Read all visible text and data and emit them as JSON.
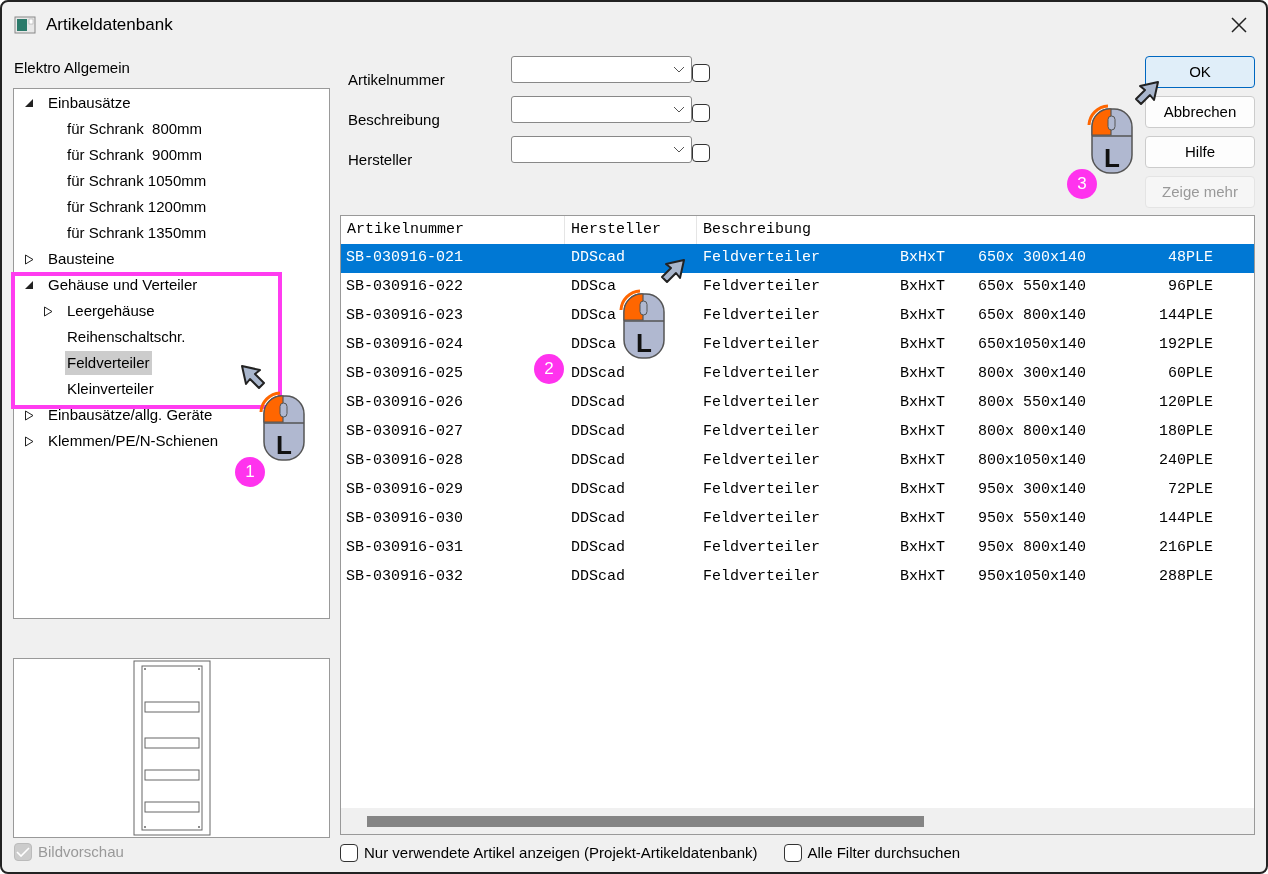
{
  "window": {
    "title": "Artikeldatenbank"
  },
  "catalog_label": "Elektro Allgemein",
  "tree": [
    {
      "label": "Einbausätze",
      "expanded": true,
      "selected": false,
      "children": [
        {
          "label": "für Schrank  800mm",
          "selected": false
        },
        {
          "label": "für Schrank  900mm",
          "selected": false
        },
        {
          "label": "für Schrank 1050mm",
          "selected": false
        },
        {
          "label": "für Schrank 1200mm",
          "selected": false
        },
        {
          "label": "für Schrank 1350mm",
          "selected": false
        }
      ]
    },
    {
      "label": "Bausteine",
      "expanded": false,
      "selected": false
    },
    {
      "label": "Gehäuse und Verteiler",
      "expanded": true,
      "selected": false,
      "children": [
        {
          "label": "Leergehäuse",
          "expanded": false,
          "selected": false
        },
        {
          "label": "Reihenschaltschr.",
          "selected": false
        },
        {
          "label": "Feldverteiler",
          "selected": true
        },
        {
          "label": "Kleinverteiler",
          "selected": false
        }
      ]
    },
    {
      "label": "Einbausätze/allg. Geräte",
      "expanded": false,
      "selected": false
    },
    {
      "label": "Klemmen/PE/N-Schienen",
      "expanded": false,
      "selected": false
    }
  ],
  "preview_checkbox": {
    "label": "Bildvorschau",
    "checked": true,
    "disabled": true
  },
  "filters": [
    {
      "label": "Artikelnummer",
      "checked": false
    },
    {
      "label": "Beschreibung",
      "checked": false
    },
    {
      "label": "Hersteller",
      "checked": false
    }
  ],
  "buttons": [
    {
      "label": "OK",
      "default": true,
      "disabled": false
    },
    {
      "label": "Abbrechen",
      "default": false,
      "disabled": false
    },
    {
      "label": "Hilfe",
      "default": false,
      "disabled": false
    },
    {
      "label": "Zeige mehr",
      "default": false,
      "disabled": true
    }
  ],
  "table": {
    "columns": [
      "Artikelnummer",
      "Hersteller",
      "Beschreibung"
    ],
    "rows": [
      {
        "selected": true,
        "cells": [
          "SB-030916-021",
          "DDScad",
          "Feldverteiler",
          "BxHxT",
          "650x 300x140",
          "48PLE"
        ]
      },
      {
        "selected": false,
        "cells": [
          "SB-030916-022",
          "DDSca",
          "Feldverteiler",
          "BxHxT",
          "650x 550x140",
          "96PLE"
        ]
      },
      {
        "selected": false,
        "cells": [
          "SB-030916-023",
          "DDSca",
          "Feldverteiler",
          "BxHxT",
          "650x 800x140",
          "144PLE"
        ]
      },
      {
        "selected": false,
        "cells": [
          "SB-030916-024",
          "DDSca",
          "Feldverteiler",
          "BxHxT",
          "650x1050x140",
          "192PLE"
        ]
      },
      {
        "selected": false,
        "cells": [
          "SB-030916-025",
          "DDScad",
          "Feldverteiler",
          "BxHxT",
          "800x 300x140",
          "60PLE"
        ]
      },
      {
        "selected": false,
        "cells": [
          "SB-030916-026",
          "DDScad",
          "Feldverteiler",
          "BxHxT",
          "800x 550x140",
          "120PLE"
        ]
      },
      {
        "selected": false,
        "cells": [
          "SB-030916-027",
          "DDScad",
          "Feldverteiler",
          "BxHxT",
          "800x 800x140",
          "180PLE"
        ]
      },
      {
        "selected": false,
        "cells": [
          "SB-030916-028",
          "DDScad",
          "Feldverteiler",
          "BxHxT",
          "800x1050x140",
          "240PLE"
        ]
      },
      {
        "selected": false,
        "cells": [
          "SB-030916-029",
          "DDScad",
          "Feldverteiler",
          "BxHxT",
          "950x 300x140",
          "72PLE"
        ]
      },
      {
        "selected": false,
        "cells": [
          "SB-030916-030",
          "DDScad",
          "Feldverteiler",
          "BxHxT",
          "950x 550x140",
          "144PLE"
        ]
      },
      {
        "selected": false,
        "cells": [
          "SB-030916-031",
          "DDScad",
          "Feldverteiler",
          "BxHxT",
          "950x 800x140",
          "216PLE"
        ]
      },
      {
        "selected": false,
        "cells": [
          "SB-030916-032",
          "DDScad",
          "Feldverteiler",
          "BxHxT",
          "950x1050x140",
          "288PLE"
        ]
      }
    ]
  },
  "bottom_options": [
    {
      "label": "Nur verwendete Artikel anzeigen (Projekt-Artikeldatenbank)",
      "checked": false
    },
    {
      "label": "Alle Filter durchsuchen",
      "checked": false
    }
  ],
  "annotations": [
    {
      "number": "1",
      "mouse_label": "L",
      "highlight": true
    },
    {
      "number": "2",
      "mouse_label": "L",
      "highlight": false
    },
    {
      "number": "3",
      "mouse_label": "L",
      "highlight": false
    }
  ]
}
